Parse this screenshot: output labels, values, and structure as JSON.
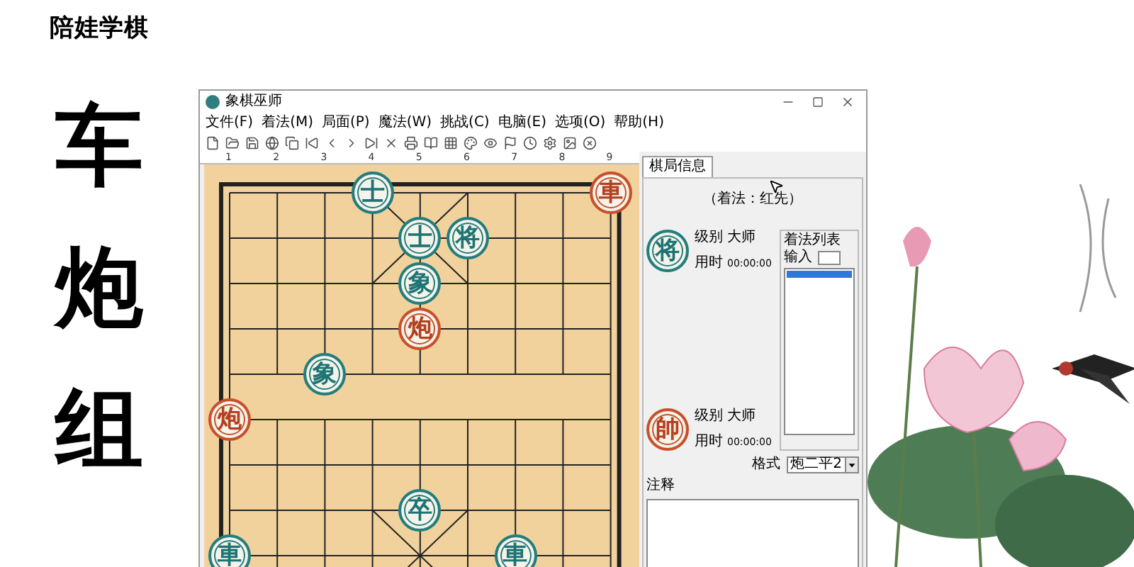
{
  "logo": "陪娃学棋",
  "calligraphy": [
    "车",
    "炮",
    "组"
  ],
  "window": {
    "title": "象棋巫师"
  },
  "menu": [
    "文件(F)",
    "着法(M)",
    "局面(P)",
    "魔法(W)",
    "挑战(C)",
    "电脑(E)",
    "选项(O)",
    "帮助(H)"
  ],
  "ruler": [
    "1",
    "2",
    "3",
    "4",
    "5",
    "6",
    "7",
    "8",
    "9"
  ],
  "board": {
    "rows": [
      [
        null,
        null,
        null,
        {
          "label": "士",
          "kind": "black"
        },
        null,
        null,
        null,
        null,
        {
          "label": "車",
          "kind": "red"
        }
      ],
      [
        null,
        null,
        null,
        null,
        {
          "label": "士",
          "kind": "black"
        },
        {
          "label": "将",
          "kind": "black"
        },
        null,
        null,
        null
      ],
      [
        null,
        null,
        null,
        null,
        {
          "label": "象",
          "kind": "black"
        },
        null,
        null,
        null,
        null
      ],
      [
        null,
        null,
        null,
        null,
        {
          "label": "炮",
          "kind": "red"
        },
        null,
        null,
        null,
        null
      ],
      [
        null,
        null,
        {
          "label": "象",
          "kind": "black"
        },
        null,
        null,
        null,
        null,
        null,
        null
      ],
      [
        {
          "label": "炮",
          "kind": "red"
        },
        null,
        null,
        null,
        null,
        null,
        null,
        null,
        null
      ],
      [
        null,
        null,
        null,
        null,
        null,
        null,
        null,
        null,
        null
      ],
      [
        null,
        null,
        null,
        null,
        {
          "label": "卒",
          "kind": "black"
        },
        null,
        null,
        null,
        null
      ],
      [
        {
          "label": "車",
          "kind": "black"
        },
        null,
        null,
        null,
        null,
        null,
        {
          "label": "車",
          "kind": "black"
        },
        null,
        null
      ]
    ]
  },
  "panel": {
    "tabs": [
      {
        "label": "棋局信息",
        "selected": true
      }
    ],
    "status": "（着法：红先）",
    "players": [
      {
        "kind": "black",
        "piece": "将",
        "level_label": "级别",
        "level": "大师",
        "time_label": "用时",
        "time": "00:00:00"
      },
      {
        "kind": "red",
        "piece": "帥",
        "level_label": "级别",
        "level": "大师",
        "time_label": "用时",
        "time": "00:00:00"
      }
    ],
    "move_list": {
      "title": "着法列表",
      "input_label": "输入",
      "items": [
        {
          "selected": true
        }
      ]
    },
    "format": {
      "label": "格式",
      "value": "炮二平2"
    },
    "comment": {
      "label": "注释"
    }
  }
}
